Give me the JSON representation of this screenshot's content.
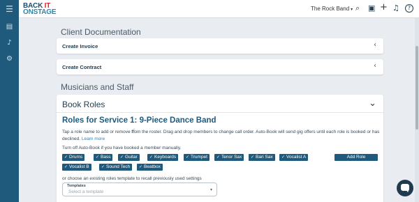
{
  "app": {
    "logo_line1a": "BACK ",
    "logo_line1b": "IT",
    "logo_line2": "ONSTAGE",
    "band_name": "The Rock Band"
  },
  "icons": {
    "menu": "☰",
    "gig_list": "▤",
    "music": "♪",
    "settings": "⚙",
    "search": "⌕",
    "calendar": "▣",
    "add": "+",
    "bell": "♫",
    "help": "?",
    "check": "✓",
    "chevron_left": "‹",
    "chevron_down": "⌄",
    "select_caret": "▾"
  },
  "client_docs": {
    "title": "Client Documentation",
    "create_invoice": "Create Invoice",
    "create_contract": "Create Contract"
  },
  "musicians": {
    "title": "Musicians and Staff"
  },
  "book_roles": {
    "title": "Book Roles",
    "subtitle": "Roles for Service 1: 9-Piece Dance Band",
    "description": "Tap a role name to add or remove from the roster. Drag and drop members to change call order. Auto-Book will send gig offers until each role is booked or has declined.",
    "learn_more": "Learn more",
    "autobook_note": "Turn off Auto-Book if you have booked a member manually.",
    "roles": [
      "Drums",
      "Bass",
      "Guitar",
      "Keyboards",
      "Trumpet",
      "Tenor Sax",
      "Bari Sax",
      "Vocalist A",
      "Vocalist B",
      "Sound Tech",
      "Beatbox"
    ],
    "add_role": "Add Role",
    "template_note": "or choose an existing roles template to recall previously used settings",
    "template_label": "Templates",
    "template_placeholder": "Select a template"
  }
}
